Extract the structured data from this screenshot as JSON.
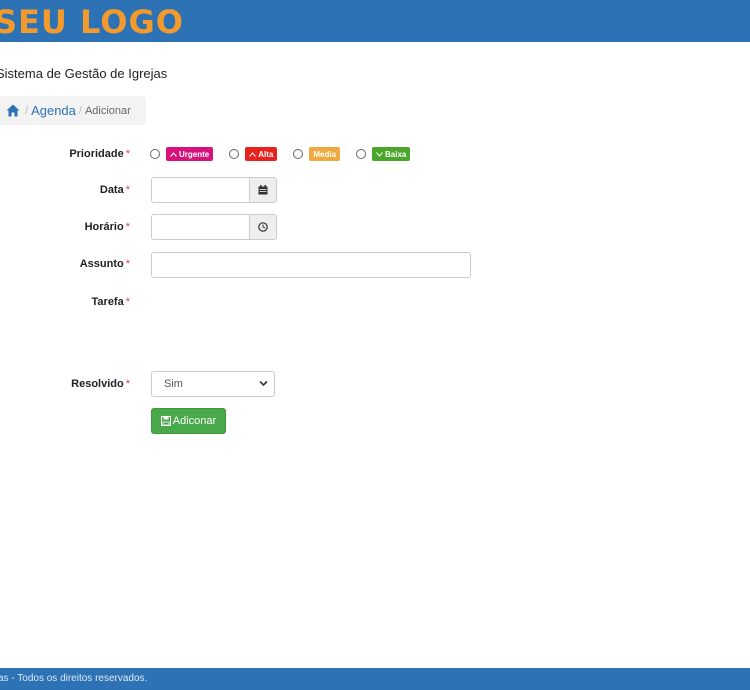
{
  "header": {
    "logo_text": "SEU LOGO",
    "bar_color": "#2c72b5",
    "logo_color": "#f39a2d"
  },
  "app_title": "Sistema de Gestão de Igrejas",
  "breadcrumb": {
    "home_icon": "home-icon",
    "agenda": "Agenda",
    "current": "Adicionar",
    "separator": "/"
  },
  "form": {
    "required_mark": "*",
    "prioridade": {
      "label": "Prioridade",
      "options": [
        {
          "label": "Urgente",
          "color": "#d6137a",
          "icon": "chevron-up-icon"
        },
        {
          "label": "Alta",
          "color": "#e8231f",
          "icon": "chevron-up-icon"
        },
        {
          "label": "Media",
          "color": "#f0a93e",
          "icon": ""
        },
        {
          "label": "Baixa",
          "color": "#4aa62a",
          "icon": "chevron-down-icon"
        }
      ]
    },
    "data": {
      "label": "Data",
      "value": "",
      "addon_icon": "calendar-icon"
    },
    "horario": {
      "label": "Horário",
      "value": "",
      "addon_icon": "clock-icon"
    },
    "assunto": {
      "label": "Assunto",
      "value": ""
    },
    "tarefa": {
      "label": "Tarefa"
    },
    "resolvido": {
      "label": "Resolvido",
      "selected": "Sim"
    },
    "submit": {
      "label": "Adiconar",
      "icon": "floppy-disk-icon",
      "color": "#48a84a"
    }
  },
  "footer": {
    "text": "as - Todos os direitos reservados."
  }
}
